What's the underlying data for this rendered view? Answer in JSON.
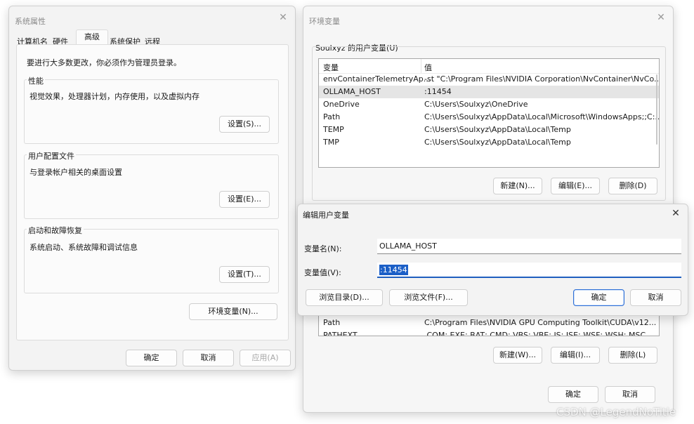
{
  "sysprops": {
    "title": "系统属性",
    "tabs": [
      "计算机名",
      "硬件",
      "高级",
      "系统保护",
      "远程"
    ],
    "admin_note": "要进行大多数更改，你必须作为管理员登录。",
    "perf": {
      "label": "性能",
      "desc": "视觉效果，处理器计划，内存使用，以及虚拟内存",
      "button": "设置(S)..."
    },
    "profile": {
      "label": "用户配置文件",
      "desc": "与登录帐户相关的桌面设置",
      "button": "设置(E)..."
    },
    "startup": {
      "label": "启动和故障恢复",
      "desc": "系统启动、系统故障和调试信息",
      "button": "设置(T)..."
    },
    "env_button": "环境变量(N)...",
    "ok": "确定",
    "cancel": "取消",
    "apply": "应用(A)"
  },
  "envvars": {
    "title": "环境变量",
    "user_group": "Soulxyz 的用户变量(U)",
    "col_var": "变量",
    "col_val": "值",
    "user_rows": [
      {
        "name": "envContainerTelemetryAp...",
        "value": "-st \"C:\\Program Files\\NVIDIA Corporation\\NvContainer\\NvCo..."
      },
      {
        "name": "OLLAMA_HOST",
        "value": ":11454"
      },
      {
        "name": "OneDrive",
        "value": "C:\\Users\\Soulxyz\\OneDrive"
      },
      {
        "name": "Path",
        "value": "C:\\Users\\Soulxyz\\AppData\\Local\\Microsoft\\WindowsApps;;C:..."
      },
      {
        "name": "TEMP",
        "value": "C:\\Users\\Soulxyz\\AppData\\Local\\Temp"
      },
      {
        "name": "TMP",
        "value": "C:\\Users\\Soulxyz\\AppData\\Local\\Temp"
      }
    ],
    "user_new": "新建(N)...",
    "user_edit": "编辑(E)...",
    "user_delete": "删除(D)",
    "sys_rows": [
      {
        "name": "Path",
        "value": "C:\\Program Files\\NVIDIA GPU Computing Toolkit\\CUDA\\v12..."
      },
      {
        "name": "PATHEXT",
        "value": ".COM;.EXE;.BAT;.CMD;.VBS;.VBE;.JS;.JSE;.WSF;.WSH;.MSC"
      }
    ],
    "sys_new": "新建(W)...",
    "sys_edit": "编辑(I)...",
    "sys_delete": "删除(L)",
    "ok": "确定",
    "cancel": "取消"
  },
  "editdlg": {
    "title": "编辑用户变量",
    "name_label": "变量名(N):",
    "name_value": "OLLAMA_HOST",
    "value_label": "变量值(V):",
    "value_value": ":11454",
    "browse_dir": "浏览目录(D)...",
    "browse_file": "浏览文件(F)...",
    "ok": "确定",
    "cancel": "取消"
  },
  "watermark": "CSDN @LegendNoTitle"
}
